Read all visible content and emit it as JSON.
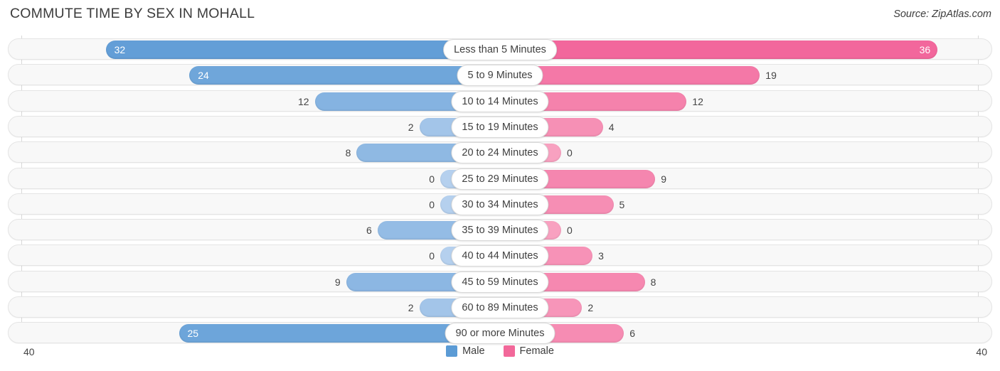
{
  "header": {
    "title": "COMMUTE TIME BY SEX IN MOHALL",
    "source": "Source: ZipAtlas.com"
  },
  "axis": {
    "left_label": "40",
    "right_label": "40",
    "max": 40
  },
  "legend": {
    "items": [
      {
        "label": "Male",
        "color": "#5b9bd5",
        "icon": "male-color-swatch"
      },
      {
        "label": "Female",
        "color": "#f2689a",
        "icon": "female-color-swatch"
      }
    ]
  },
  "chart_data": {
    "type": "bar",
    "orientation": "horizontal-diverging",
    "title": "COMMUTE TIME BY SEX IN MOHALL",
    "xlabel": "",
    "ylabel": "",
    "xlim": [
      40,
      40
    ],
    "grid": true,
    "legend_position": "bottom-center",
    "categories": [
      "Less than 5 Minutes",
      "5 to 9 Minutes",
      "10 to 14 Minutes",
      "15 to 19 Minutes",
      "20 to 24 Minutes",
      "25 to 29 Minutes",
      "30 to 34 Minutes",
      "35 to 39 Minutes",
      "40 to 44 Minutes",
      "45 to 59 Minutes",
      "60 to 89 Minutes",
      "90 or more Minutes"
    ],
    "series": [
      {
        "name": "Male",
        "color": "#5b9bd5",
        "values": [
          32,
          24,
          12,
          2,
          8,
          0,
          0,
          6,
          0,
          9,
          2,
          25
        ]
      },
      {
        "name": "Female",
        "color": "#f2689a",
        "values": [
          36,
          19,
          12,
          4,
          0,
          9,
          5,
          0,
          3,
          8,
          2,
          6
        ]
      }
    ]
  }
}
